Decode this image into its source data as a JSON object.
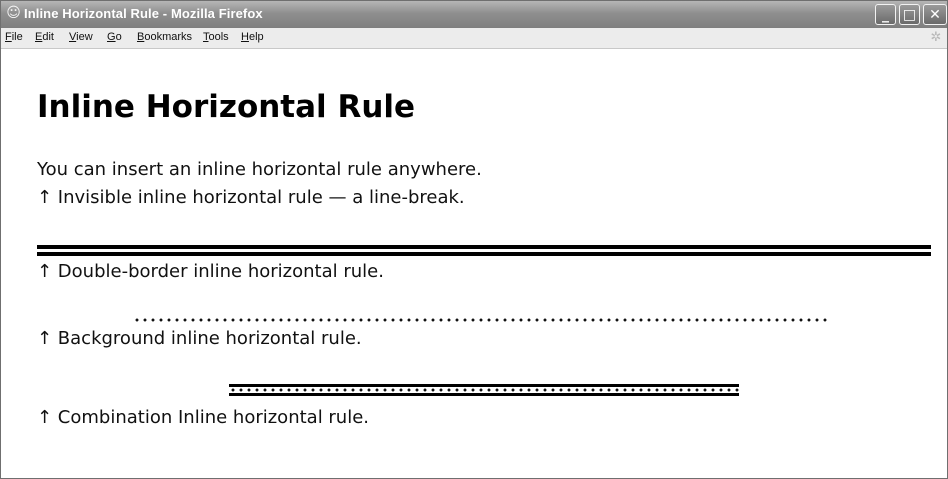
{
  "window": {
    "title": "Inline Horizontal Rule - Mozilla Firefox",
    "controls": {
      "minimize": "_",
      "maximize": "□",
      "close": "✕"
    }
  },
  "menubar": {
    "items": [
      {
        "label": "File",
        "accel": "F"
      },
      {
        "label": "Edit",
        "accel": "E"
      },
      {
        "label": "View",
        "accel": "V"
      },
      {
        "label": "Go",
        "accel": "G"
      },
      {
        "label": "Bookmarks",
        "accel": "B"
      },
      {
        "label": "Tools",
        "accel": "T"
      },
      {
        "label": "Help",
        "accel": "H"
      }
    ]
  },
  "page": {
    "heading": "Inline Horizontal Rule",
    "intro": "You can insert an inline horizontal rule anywhere.",
    "invisible_caption": "↑ Invisible inline horizontal rule — a line-break.",
    "double_caption": "↑ Double-border inline horizontal rule.",
    "background_caption": "↑ Background inline horizontal rule.",
    "combination_caption": "↑ Combination Inline horizontal rule."
  },
  "icons": {
    "app": "firefox-icon",
    "throbber": "throbber-icon"
  }
}
